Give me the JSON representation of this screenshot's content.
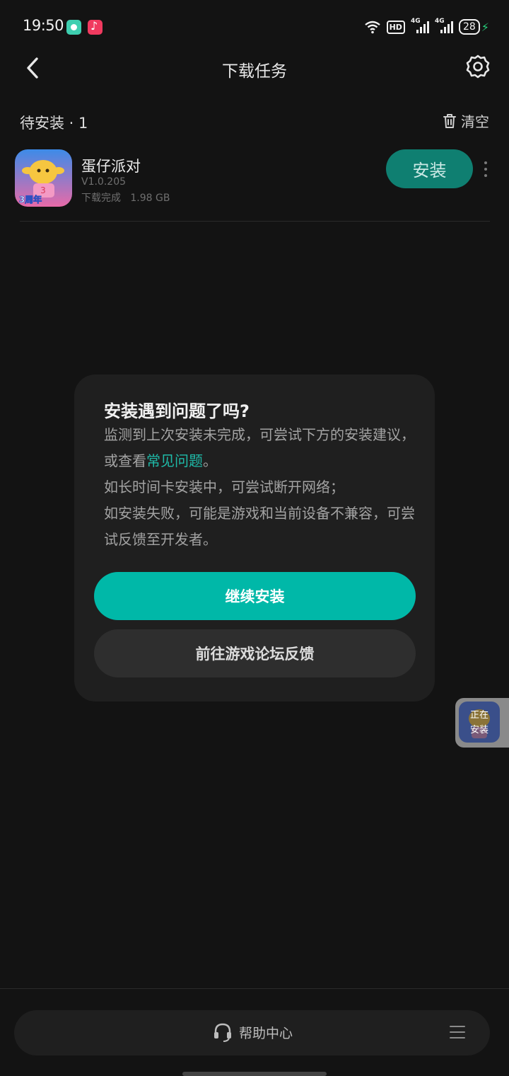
{
  "status_bar": {
    "time": "19:50",
    "hd": "HD",
    "signal_1": "4G",
    "signal_2": "4G",
    "battery": "28",
    "icons": [
      "notification-app-icon",
      "music-app-icon",
      "wifi-icon",
      "hd-icon",
      "signal-icon",
      "signal-icon",
      "battery-icon",
      "charging-icon"
    ]
  },
  "header": {
    "title": "下载任务",
    "back_icon": "chevron-left-icon",
    "settings_icon": "gear-icon"
  },
  "section": {
    "title": "待安装 · 1",
    "clear_label": "清空",
    "clear_icon": "trash-icon"
  },
  "download_item": {
    "name": "蛋仔派对",
    "version": "V1.0.205",
    "status": "下载完成",
    "size": "1.98 GB",
    "install_label": "安装",
    "icon_badge": "3周年"
  },
  "dialog": {
    "title": "安装遇到问题了吗?",
    "line1_pre": "监测到上次安装未完成，可尝试下方的安装建议，或查看",
    "faq_link": "常见问题",
    "line1_post": "。",
    "line2": "如长时间卡安装中，可尝试断开网络；",
    "line3": "如安装失败，可能是游戏和当前设备不兼容，可尝试反馈至开发者。",
    "primary_label": "继续安装",
    "secondary_label": "前往游戏论坛反馈"
  },
  "floating_widget": {
    "line1": "正在",
    "line2": "安装"
  },
  "bottom_bar": {
    "help_label": "帮助中心",
    "help_icon": "headset-icon",
    "menu_icon": "menu-icon"
  },
  "colors": {
    "accent": "#00b8a8",
    "background": "#131313",
    "card": "#1f1f1f",
    "link": "#1fbaa8"
  }
}
